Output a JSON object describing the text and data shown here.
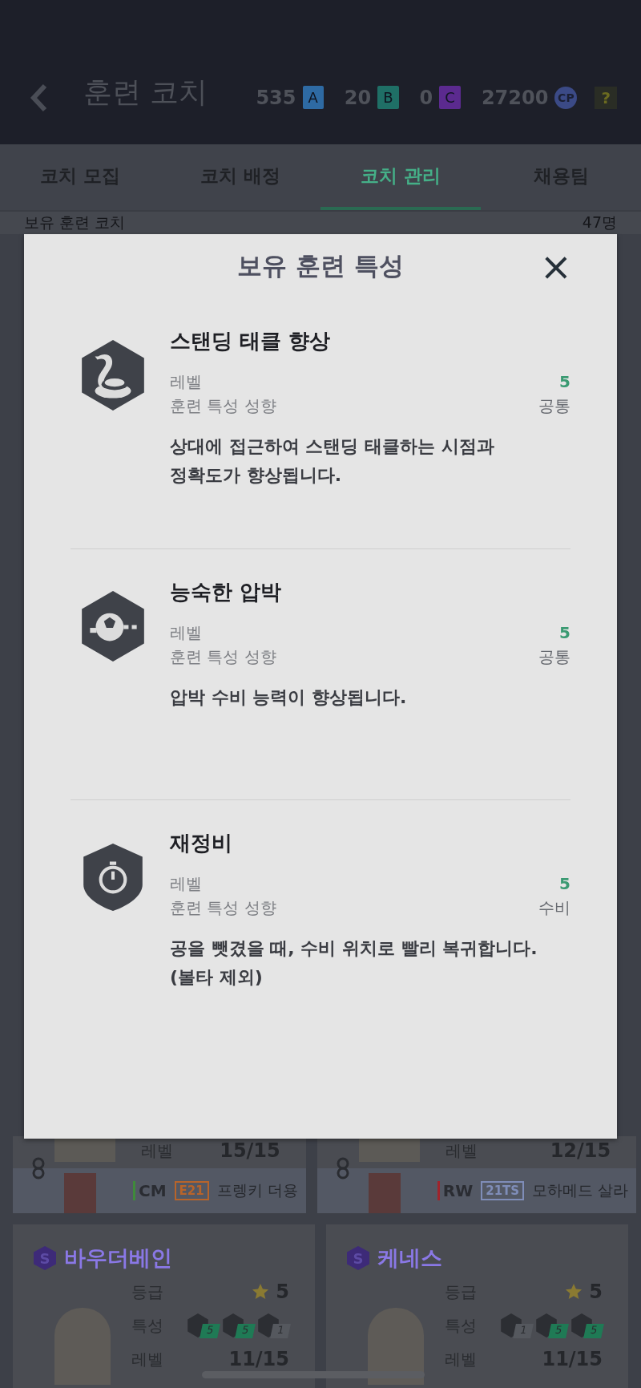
{
  "header": {
    "title": "훈련 코치",
    "currencies": [
      {
        "amount": "535",
        "symbol": "A",
        "color": "#2e6aa3"
      },
      {
        "amount": "20",
        "symbol": "B",
        "color": "#1f6f66"
      },
      {
        "amount": "0",
        "symbol": "C",
        "color": "#5b2a8f"
      },
      {
        "amount": "27200",
        "symbol": "CP",
        "color": "#3b4a86"
      }
    ],
    "help": "?"
  },
  "tabs": [
    {
      "label": "코치 모집",
      "selected": false
    },
    {
      "label": "코치 배정",
      "selected": false
    },
    {
      "label": "코치 관리",
      "selected": true
    },
    {
      "label": "채용팀",
      "selected": false
    }
  ],
  "coach_count": {
    "label": "보유 훈련 코치",
    "value": "47명"
  },
  "modal": {
    "title": "보유 훈련 특성",
    "close": "×",
    "traits": [
      {
        "kind": "hexagon",
        "name": "스탠딩 태클 향상",
        "level_label": "레벨",
        "level": "5",
        "tendency_label": "훈련 특성 성향",
        "tendency": "공통",
        "description": "상대에 접근하여 스탠딩 태클하는 시점과\n정확도가 향상됩니다."
      },
      {
        "kind": "hexagon",
        "name": "능숙한 압박",
        "level_label": "레벨",
        "level": "5",
        "tendency_label": "훈련 특성 성향",
        "tendency": "공통",
        "description": "압박 수비 능력이 향상됩니다."
      },
      {
        "kind": "shield",
        "name": "재정비",
        "level_label": "레벨",
        "level": "5",
        "tendency_label": "훈련 특성 성향",
        "tendency": "수비",
        "description": "공을 뺏겼을 때, 수비 위치로 빨리 복귀합니다.\n(볼타 제외)"
      }
    ]
  },
  "partial_cards": [
    {
      "level_label": "레벨",
      "level": "15/15",
      "player": {
        "position": {
          "label": "CM",
          "color": "#3f8a3a"
        },
        "season": {
          "label": "E21",
          "color": "#b8642a"
        },
        "name": "프렝키 더용"
      }
    },
    {
      "level_label": "레벨",
      "level": "12/15",
      "player": {
        "position": {
          "label": "RW",
          "color": "#a0242c"
        },
        "season": {
          "label": "21TS",
          "color": "#7f8db8"
        },
        "name": "모하메드 살라"
      }
    }
  ],
  "cards": [
    {
      "badge": "S",
      "name": "바우더베인",
      "grade_label": "등급",
      "grade": "5",
      "trait_label": "특성",
      "traits": [
        {
          "value": "5",
          "color": "#1f7a55"
        },
        {
          "value": "5",
          "color": "#1f7a55"
        },
        {
          "value": "1",
          "color": "#55585e"
        }
      ],
      "level_label": "레벨",
      "level": "11/15"
    },
    {
      "badge": "S",
      "name": "케네스",
      "grade_label": "등급",
      "grade": "5",
      "trait_label": "특성",
      "traits": [
        {
          "value": "1",
          "color": "#55585e"
        },
        {
          "value": "5",
          "color": "#1f7a55"
        },
        {
          "value": "5",
          "color": "#1f7a55"
        }
      ],
      "level_label": "레벨",
      "level": "11/15"
    }
  ]
}
